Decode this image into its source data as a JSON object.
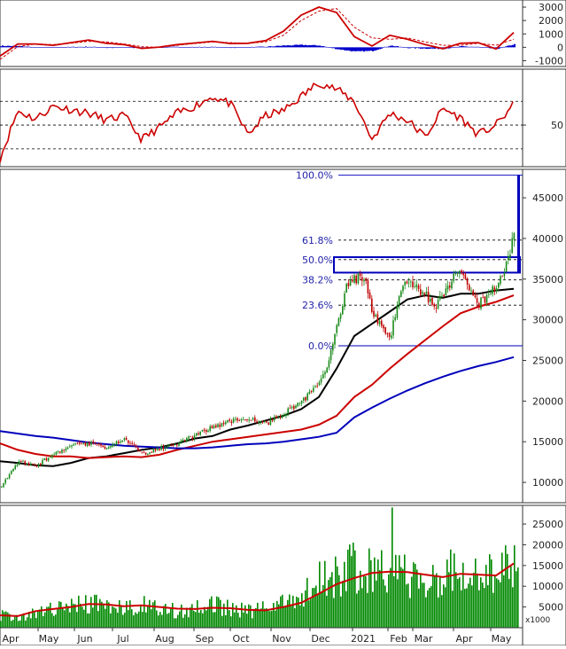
{
  "colors": {
    "price_up": "#1a8a1a",
    "price_down": "#c00000",
    "ma_black": "#000000",
    "ma_red": "#cc0000",
    "ma_blue": "#0000bb",
    "fib_text": "#2222aa",
    "macd_hist": "#0000cc",
    "macd_line": "#cc0000",
    "rsi_line": "#cc0000",
    "volume_bar": "#008800",
    "volume_ma": "#cc0000",
    "axis": "#222222",
    "grid_dash": "#000000"
  },
  "chart_data": [
    {
      "id": "macd",
      "type": "line",
      "yticks": [
        3000,
        2000,
        1000,
        0,
        -1000
      ],
      "ylim": [
        -1300,
        3400
      ],
      "series": [
        {
          "kind": "line",
          "x": [
            0,
            20,
            40,
            60,
            80,
            100,
            120,
            140,
            160,
            180,
            200,
            220,
            240,
            260,
            280,
            300,
            320,
            340,
            360,
            380,
            400,
            420,
            440,
            460,
            480,
            500,
            520,
            540,
            560,
            580
          ],
          "values": [
            -650,
            250,
            250,
            150,
            350,
            550,
            300,
            200,
            -80,
            20,
            200,
            320,
            450,
            280,
            300,
            500,
            1200,
            2400,
            3000,
            2600,
            800,
            100,
            900,
            600,
            200,
            -100,
            300,
            350,
            -120,
            1100
          ]
        },
        {
          "kind": "line",
          "x": [
            0,
            20,
            40,
            60,
            80,
            100,
            120,
            140,
            160,
            180,
            200,
            220,
            240,
            260,
            280,
            300,
            320,
            340,
            360,
            380,
            400,
            420,
            440,
            460,
            480,
            500,
            520,
            540,
            560,
            580
          ],
          "values": [
            -900,
            50,
            250,
            200,
            300,
            450,
            400,
            250,
            50,
            0,
            150,
            280,
            400,
            350,
            300,
            400,
            900,
            2000,
            2700,
            2900,
            1500,
            700,
            600,
            700,
            400,
            150,
            150,
            300,
            150,
            600
          ]
        }
      ]
    },
    {
      "id": "rsi",
      "type": "line",
      "yticks": [
        50
      ],
      "ylim": [
        15,
        97
      ],
      "series": [
        {
          "kind": "line",
          "x": [
            0,
            20,
            40,
            60,
            80,
            100,
            120,
            140,
            160,
            180,
            200,
            220,
            240,
            260,
            280,
            300,
            320,
            340,
            360,
            380,
            400,
            420,
            440,
            460,
            480,
            500,
            520,
            540,
            560,
            580
          ],
          "values": [
            22,
            62,
            55,
            66,
            63,
            60,
            54,
            58,
            38,
            48,
            60,
            66,
            74,
            68,
            42,
            58,
            62,
            74,
            86,
            80,
            70,
            38,
            60,
            54,
            40,
            64,
            56,
            42,
            50,
            67
          ]
        }
      ]
    },
    {
      "id": "price",
      "type": "line",
      "yticks": [
        45000,
        40000,
        35000,
        30000,
        25000,
        20000,
        15000,
        10000
      ],
      "ylim": [
        7500,
        48500
      ],
      "xticks": [
        {
          "label": "Apr",
          "x": 12
        },
        {
          "label": "May",
          "x": 55
        },
        {
          "label": "Jun",
          "x": 96
        },
        {
          "label": "Jul",
          "x": 139
        },
        {
          "label": "Aug",
          "x": 186
        },
        {
          "label": "Sep",
          "x": 231
        },
        {
          "label": "Oct",
          "x": 272
        },
        {
          "label": "Nov",
          "x": 318
        },
        {
          "label": "Dec",
          "x": 362
        },
        {
          "label": "2021",
          "x": 410
        },
        {
          "label": "Feb",
          "x": 450
        },
        {
          "label": "Mar",
          "x": 478
        },
        {
          "label": "Apr",
          "x": 524
        },
        {
          "label": "May",
          "x": 566
        }
      ],
      "fib_levels": [
        {
          "label": "100.0%",
          "value": 47800
        },
        {
          "label": "61.8%",
          "value": 39800
        },
        {
          "label": "50.0%",
          "value": 37400
        },
        {
          "label": "38.2%",
          "value": 34900
        },
        {
          "label": "23.6%",
          "value": 31800
        },
        {
          "label": "0.0%",
          "value": 26800
        }
      ],
      "resistance_zone": [
        35800,
        37700
      ],
      "price_path": {
        "x": [
          0,
          20,
          40,
          60,
          80,
          100,
          120,
          140,
          160,
          180,
          200,
          220,
          240,
          260,
          280,
          300,
          320,
          340,
          360,
          370,
          380,
          390,
          400,
          410,
          420,
          430,
          440,
          450,
          460,
          470,
          480,
          490,
          500,
          510,
          520,
          530,
          540,
          550,
          560,
          570,
          580
        ],
        "values": [
          9500,
          12600,
          12000,
          13500,
          14500,
          14800,
          14300,
          15300,
          13500,
          14200,
          14800,
          15800,
          16800,
          17500,
          18000,
          17200,
          18500,
          20000,
          22000,
          24500,
          29500,
          34000,
          35000,
          35500,
          31000,
          29000,
          27500,
          33500,
          34500,
          34000,
          33000,
          31500,
          33000,
          35000,
          36000,
          34000,
          32000,
          32800,
          34500,
          36500,
          40500
        ]
      },
      "ma_lines": [
        {
          "kind": "black",
          "x": [
            0,
            20,
            40,
            60,
            80,
            100,
            120,
            140,
            160,
            180,
            200,
            220,
            240,
            260,
            280,
            300,
            320,
            340,
            360,
            380,
            400,
            420,
            440,
            460,
            480,
            500,
            520,
            540,
            560,
            580
          ],
          "values": [
            12600,
            12400,
            12100,
            12000,
            12400,
            13000,
            13200,
            13600,
            14000,
            14300,
            14800,
            15400,
            15700,
            16500,
            17000,
            17600,
            18200,
            19000,
            20500,
            24000,
            28000,
            29500,
            31000,
            32500,
            33000,
            32700,
            33200,
            33200,
            33600,
            33800
          ]
        },
        {
          "kind": "red",
          "x": [
            0,
            20,
            40,
            60,
            80,
            100,
            120,
            140,
            160,
            180,
            200,
            220,
            240,
            260,
            280,
            300,
            320,
            340,
            360,
            380,
            400,
            420,
            440,
            460,
            480,
            500,
            520,
            540,
            560,
            580
          ],
          "values": [
            14800,
            14000,
            13500,
            13200,
            13200,
            13000,
            13100,
            13200,
            13100,
            13400,
            14000,
            14500,
            15000,
            15300,
            15600,
            15900,
            16200,
            16500,
            17100,
            18200,
            20500,
            22000,
            24000,
            25800,
            27500,
            29200,
            30800,
            31600,
            32200,
            33000
          ]
        },
        {
          "kind": "blue",
          "x": [
            0,
            20,
            40,
            60,
            80,
            100,
            120,
            140,
            160,
            180,
            200,
            220,
            240,
            260,
            280,
            300,
            320,
            340,
            360,
            380,
            400,
            420,
            440,
            460,
            480,
            500,
            520,
            540,
            560,
            580
          ],
          "values": [
            16300,
            16000,
            15700,
            15500,
            15200,
            14900,
            14700,
            14500,
            14400,
            14300,
            14200,
            14200,
            14300,
            14500,
            14700,
            14800,
            15000,
            15300,
            15600,
            16100,
            18000,
            19200,
            20300,
            21300,
            22200,
            23000,
            23700,
            24300,
            24800,
            25400
          ]
        }
      ]
    },
    {
      "id": "volume",
      "type": "bar",
      "yticks": [
        25000,
        20000,
        15000,
        10000,
        5000
      ],
      "ylim": [
        0,
        29500
      ],
      "unit_label": "x1000",
      "volume_profile": {
        "x": [
          0,
          20,
          40,
          60,
          80,
          100,
          120,
          140,
          160,
          180,
          200,
          220,
          240,
          260,
          280,
          300,
          320,
          340,
          360,
          380,
          400,
          420,
          440,
          460,
          480,
          500,
          520,
          540,
          560,
          580
        ],
        "values": [
          3000,
          2500,
          3500,
          4500,
          5000,
          6000,
          5500,
          5000,
          5500,
          4500,
          4000,
          4500,
          5500,
          4500,
          4000,
          4500,
          6000,
          8000,
          11000,
          13000,
          14500,
          14000,
          13000,
          12500,
          12000,
          13000,
          14000,
          12000,
          13000,
          14500
        ]
      },
      "volume_ma": {
        "x": [
          0,
          20,
          40,
          60,
          80,
          100,
          120,
          140,
          160,
          180,
          200,
          220,
          240,
          260,
          280,
          300,
          320,
          340,
          360,
          380,
          400,
          420,
          440,
          460,
          480,
          500,
          520,
          540,
          560,
          580
        ],
        "values": [
          3000,
          2800,
          4000,
          4500,
          5000,
          5700,
          5600,
          5200,
          5400,
          5000,
          4600,
          4500,
          4800,
          4700,
          4300,
          4200,
          5000,
          6000,
          8200,
          10500,
          12000,
          13200,
          13500,
          13400,
          12800,
          12200,
          13000,
          12800,
          12600,
          15500
        ]
      }
    }
  ]
}
